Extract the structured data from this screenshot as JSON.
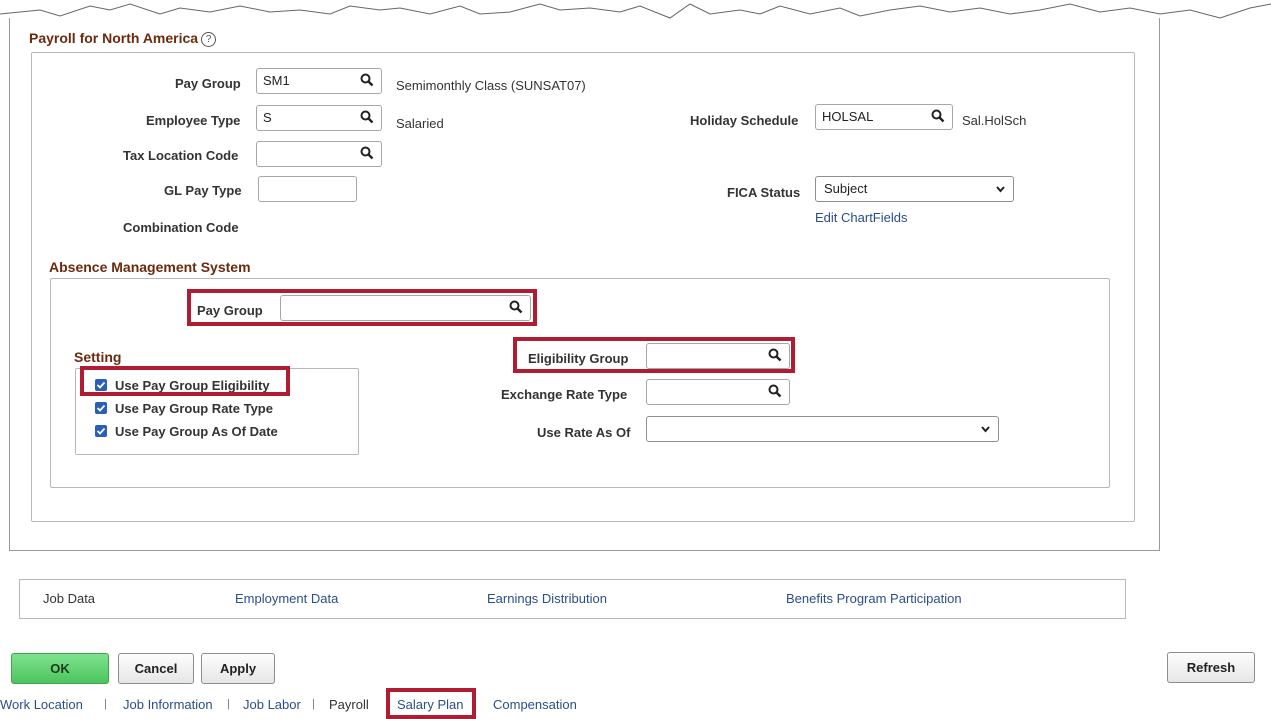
{
  "section": {
    "title": "Payroll for North America",
    "help_icon": "question-circle-icon"
  },
  "payroll": {
    "pay_group": {
      "label": "Pay Group",
      "value": "SM1",
      "description": "Semimonthly Class (SUNSAT07)"
    },
    "employee_type": {
      "label": "Employee Type",
      "value": "S",
      "description": "Salaried"
    },
    "tax_location": {
      "label": "Tax Location Code",
      "value": ""
    },
    "gl_pay_type": {
      "label": "GL Pay Type",
      "value": ""
    },
    "combination_code": {
      "label": "Combination Code"
    },
    "holiday_schedule": {
      "label": "Holiday Schedule",
      "value": "HOLSAL",
      "description": "Sal.HolSch"
    },
    "fica_status": {
      "label": "FICA Status",
      "value": "Subject"
    },
    "edit_chartfields": "Edit ChartFields"
  },
  "absence": {
    "title": "Absence Management System",
    "pay_group": {
      "label": "Pay Group",
      "value": ""
    },
    "setting_title": "Setting",
    "checkboxes": [
      {
        "label": "Use Pay Group Eligibility",
        "checked": true
      },
      {
        "label": "Use Pay Group Rate Type",
        "checked": true
      },
      {
        "label": "Use Pay Group As Of Date",
        "checked": true
      }
    ],
    "eligibility_group": {
      "label": "Eligibility Group",
      "value": ""
    },
    "exchange_rate_type": {
      "label": "Exchange Rate Type",
      "value": ""
    },
    "use_rate_as_of": {
      "label": "Use Rate As Of",
      "value": ""
    }
  },
  "nav_links": [
    "Job Data",
    "Employment Data",
    "Earnings Distribution",
    "Benefits Program Participation"
  ],
  "buttons": {
    "ok": "OK",
    "cancel": "Cancel",
    "apply": "Apply",
    "refresh": "Refresh"
  },
  "tabs": [
    "Work Location",
    "Job Information",
    "Job Labor",
    "Payroll",
    "Salary Plan",
    "Compensation"
  ],
  "colors": {
    "highlight": "#b01c31",
    "section_title": "#6b2a0f",
    "link": "#2a4e8a",
    "ok_button": "#4cc45e"
  }
}
